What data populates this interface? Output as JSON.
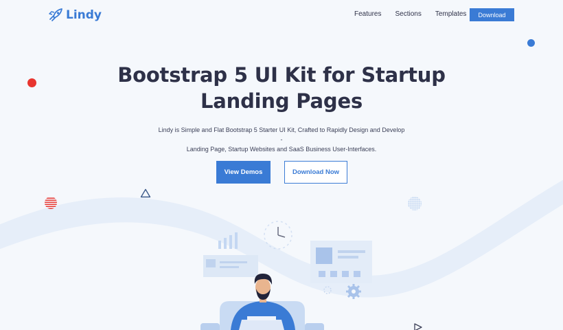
{
  "brand": {
    "name": "Lindy",
    "logo_icon": "rocket-icon"
  },
  "nav": {
    "items": [
      {
        "label": "Features"
      },
      {
        "label": "Sections"
      },
      {
        "label": "Templates"
      }
    ],
    "download_label": "Download"
  },
  "hero": {
    "title_line1": "Bootstrap 5 UI Kit for Startup",
    "title_line2": "Landing Pages",
    "subtitle_line1": "Lindy is Simple and Flat Bootstrap 5 Starter UI Kit, Crafted to Rapidly Design and Develop -",
    "subtitle_line2": "Landing Page, Startup Websites and SaaS Business User-Interfaces.",
    "primary_button": "View Demos",
    "secondary_button": "Download Now"
  },
  "colors": {
    "accent": "#3a7bd5",
    "text": "#2e3148",
    "red_dot": "#e8352f",
    "background": "#f5f8fc"
  }
}
